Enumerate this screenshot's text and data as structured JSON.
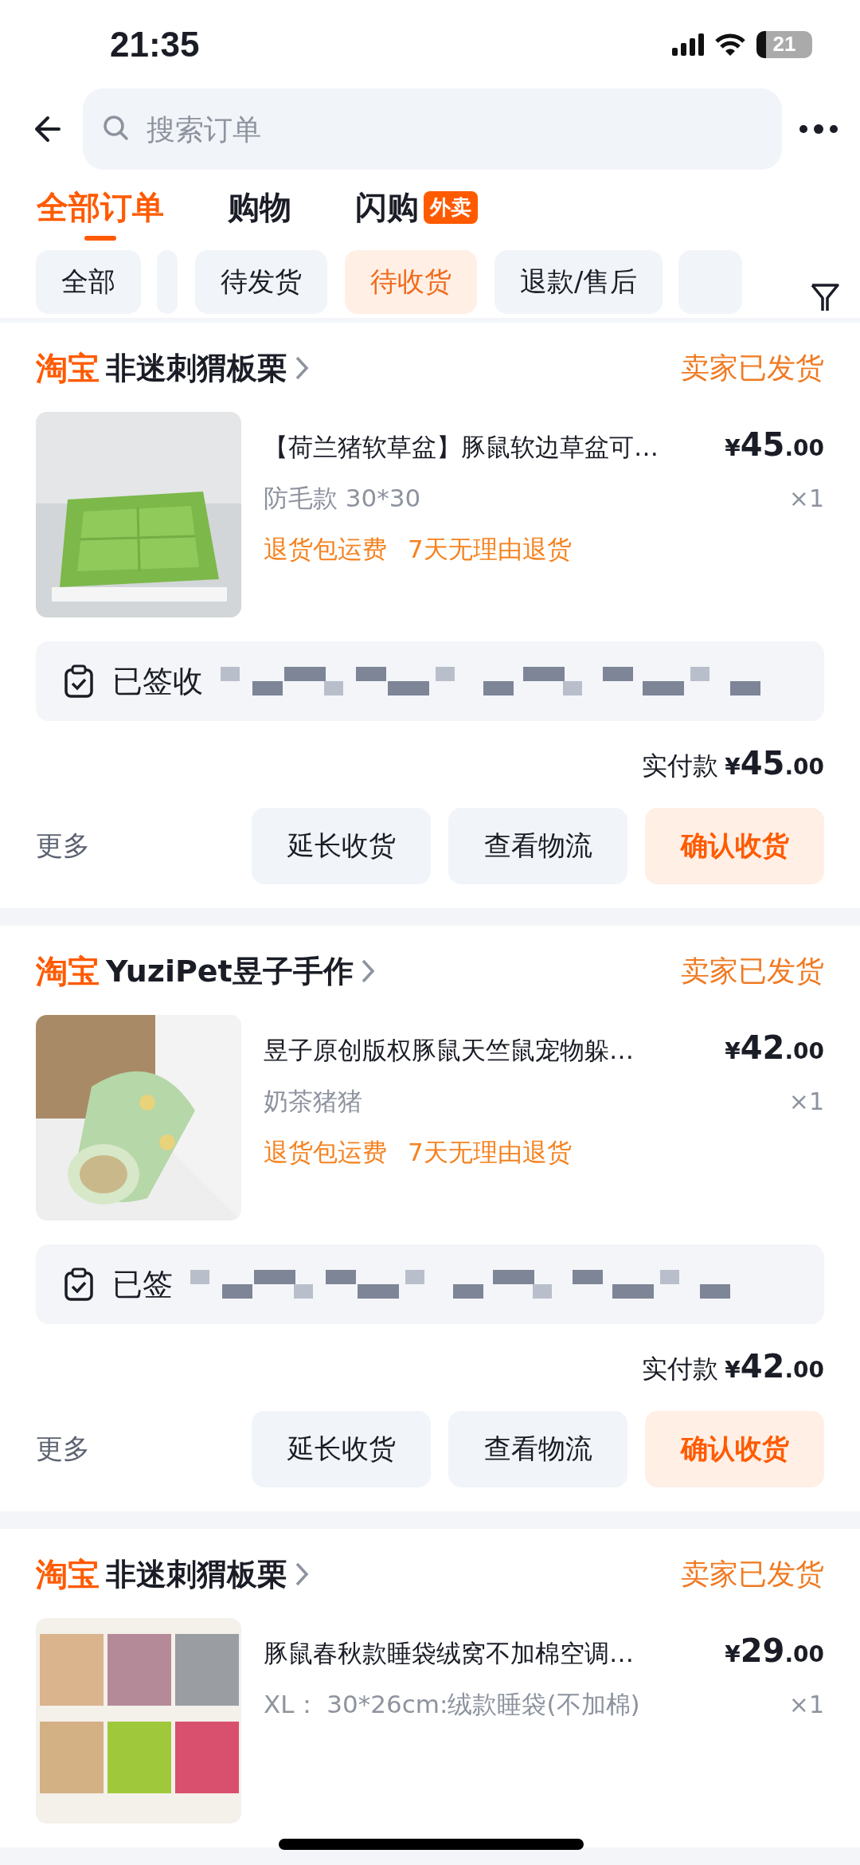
{
  "status_bar": {
    "time": "21:35",
    "battery": "21"
  },
  "search": {
    "placeholder": "搜索订单"
  },
  "tabs": [
    {
      "label": "全部订单",
      "selected": true
    },
    {
      "label": "购物",
      "selected": false
    },
    {
      "label": "闪购",
      "badge": "外卖",
      "selected": false
    }
  ],
  "filters": [
    {
      "label": "全部",
      "selected": false
    },
    {
      "kind": "partial",
      "selected": false
    },
    {
      "label": "待发货",
      "selected": false
    },
    {
      "label": "待收货",
      "selected": true
    },
    {
      "label": "退款/售后",
      "selected": false
    },
    {
      "kind": "partial",
      "selected": false
    }
  ],
  "orders": [
    {
      "platform": "淘宝",
      "shop": "非迷刺猬板栗",
      "status": "卖家已发货",
      "title": "【荷兰猪软草盆】豚鼠软边草盆可…",
      "price_symbol": "¥",
      "price_integer": "45",
      "price_decimal": ".00",
      "spec": "防毛款 30*30",
      "quantity": "×1",
      "tags": [
        "退货包运费",
        "7天无理由退货"
      ],
      "picture": {
        "kind": "picture"
      },
      "logistics": "已签收",
      "paid_label": "实付款",
      "paid_symbol": "¥",
      "paid_integer": "45",
      "paid_decimal": ".00",
      "more": "更多",
      "buttons": [
        {
          "label": "延长收货",
          "primary": false
        },
        {
          "label": "查看物流",
          "primary": false
        },
        {
          "label": "确认收货",
          "primary": true
        }
      ]
    },
    {
      "platform": "淘宝",
      "shop": "YuziPet昱子手作",
      "status": "卖家已发货",
      "title": "昱子原创版权豚鼠天竺鼠宠物躲…",
      "price_symbol": "¥",
      "price_integer": "42",
      "price_decimal": ".00",
      "spec": "奶茶猪猪",
      "quantity": "×1",
      "tags": [
        "退货包运费",
        "7天无理由退货"
      ],
      "picture": {
        "kind": "picture"
      },
      "logistics": "已签",
      "paid_label": "实付款",
      "paid_symbol": "¥",
      "paid_integer": "42",
      "paid_decimal": ".00",
      "more": "更多",
      "buttons": [
        {
          "label": "延长收货",
          "primary": false
        },
        {
          "label": "查看物流",
          "primary": false
        },
        {
          "label": "确认收货",
          "primary": true
        }
      ]
    },
    {
      "platform": "淘宝",
      "shop": "非迷刺猬板栗",
      "status": "卖家已发货",
      "title": "豚鼠春秋款睡袋绒窝不加棉空调…",
      "price_symbol": "¥",
      "price_integer": "29",
      "price_decimal": ".00",
      "spec": "XL： 30*26cm:绒款睡袋(不加棉)",
      "quantity": "×1",
      "picture": {
        "kind": "picture"
      }
    }
  ]
}
